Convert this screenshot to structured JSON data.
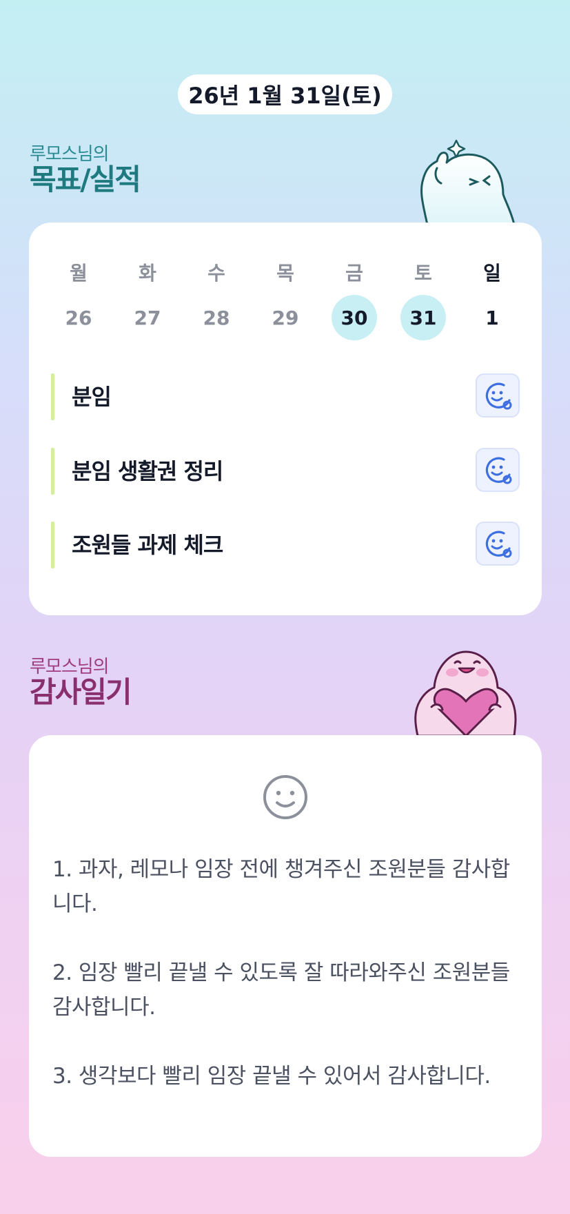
{
  "header": {
    "date_label": "26년 1월 31일(토)"
  },
  "goals_section": {
    "subtitle": "루모스님의",
    "title": "목표/실적",
    "week": [
      {
        "day": "월",
        "date": "26",
        "marked": false,
        "today": false
      },
      {
        "day": "화",
        "date": "27",
        "marked": false,
        "today": false
      },
      {
        "day": "수",
        "date": "28",
        "marked": false,
        "today": false
      },
      {
        "day": "목",
        "date": "29",
        "marked": false,
        "today": false
      },
      {
        "day": "금",
        "date": "30",
        "marked": true,
        "today": false
      },
      {
        "day": "토",
        "date": "31",
        "marked": true,
        "today": false
      },
      {
        "day": "일",
        "date": "1",
        "marked": false,
        "today": true
      }
    ],
    "items": [
      {
        "label": "분임",
        "icon": "add-reaction-icon"
      },
      {
        "label": "분임 생활권 정리",
        "icon": "add-reaction-icon"
      },
      {
        "label": "조원들 과제 체크",
        "icon": "add-reaction-icon"
      }
    ]
  },
  "thanks_section": {
    "subtitle": "루모스님의",
    "title": "감사일기",
    "mood_icon": "smiley-face-icon",
    "entries": [
      "1. 과자, 레모나 임장 전에 챙겨주신 조원분들 감사합니다.",
      "2. 임장 빨리 끝낼 수 있도록 잘 따라와주신 조원분들 감사합니다.",
      "3. 생각보다 빨리 임장 끝낼 수 있어서 감사합니다."
    ]
  },
  "colors": {
    "goal_title": "#1f7a80",
    "thanks_title": "#8a2f6e",
    "date_highlight": "#c7eff4",
    "goal_bar": "#d3ee9e",
    "reaction_icon": "#3d6fe0"
  }
}
